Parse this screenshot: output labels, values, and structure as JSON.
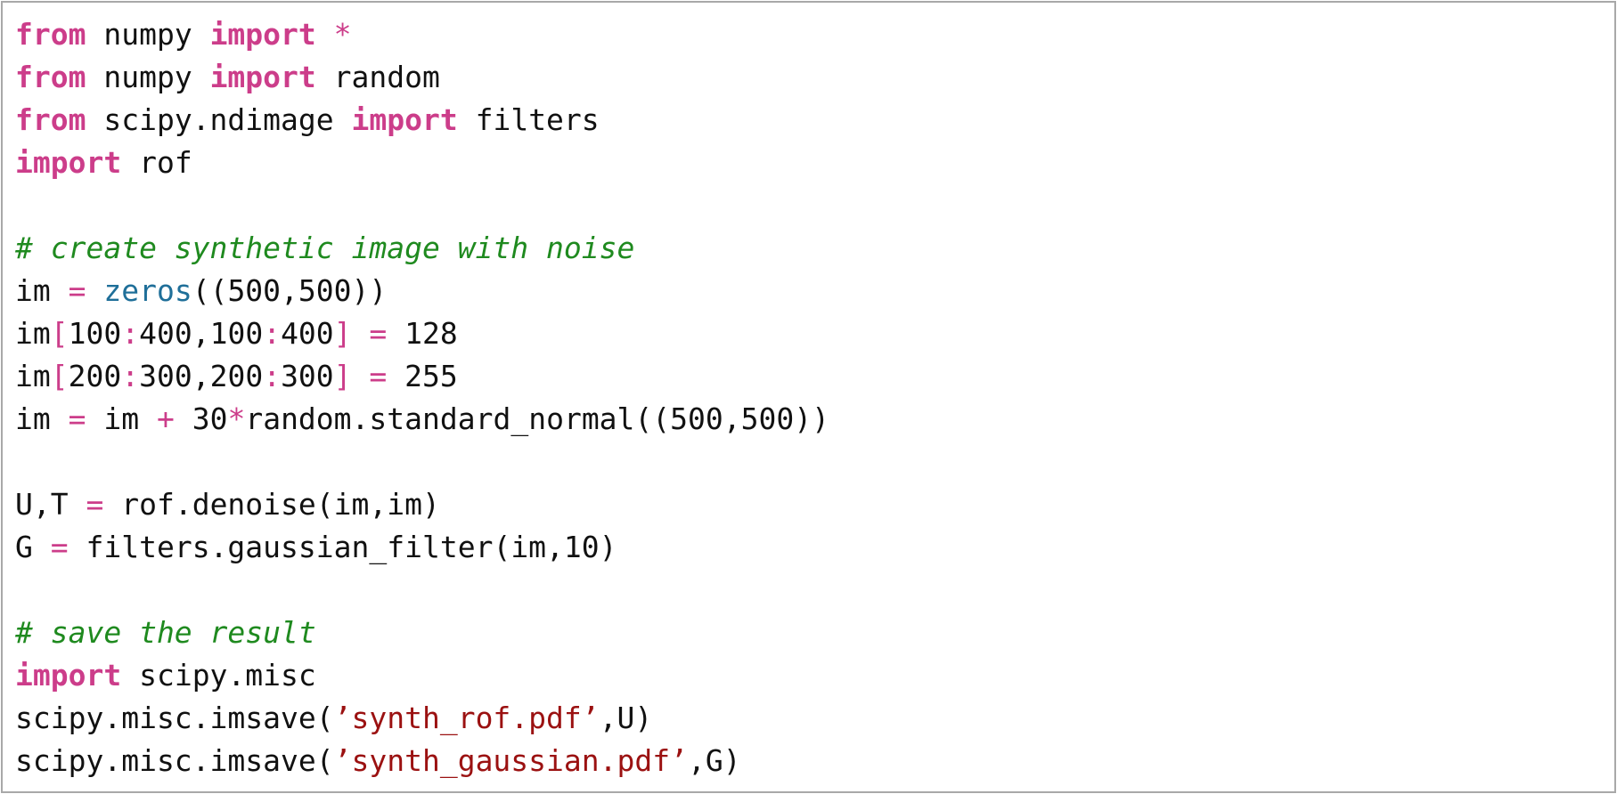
{
  "editor": {
    "lines": [
      [
        {
          "t": "kw",
          "v": "from"
        },
        {
          "t": "tx",
          "v": " numpy "
        },
        {
          "t": "kw",
          "v": "import"
        },
        {
          "t": "tx",
          "v": " "
        },
        {
          "t": "op",
          "v": "*"
        }
      ],
      [
        {
          "t": "kw",
          "v": "from"
        },
        {
          "t": "tx",
          "v": " numpy "
        },
        {
          "t": "kw",
          "v": "import"
        },
        {
          "t": "tx",
          "v": " random"
        }
      ],
      [
        {
          "t": "kw",
          "v": "from"
        },
        {
          "t": "tx",
          "v": " scipy.ndimage "
        },
        {
          "t": "kw",
          "v": "import"
        },
        {
          "t": "tx",
          "v": " filters"
        }
      ],
      [
        {
          "t": "kw",
          "v": "import"
        },
        {
          "t": "tx",
          "v": " rof"
        }
      ],
      [],
      [
        {
          "t": "cm",
          "v": "# create synthetic image with noise"
        }
      ],
      [
        {
          "t": "tx",
          "v": "im "
        },
        {
          "t": "op",
          "v": "="
        },
        {
          "t": "tx",
          "v": " "
        },
        {
          "t": "fn",
          "v": "zeros"
        },
        {
          "t": "tx",
          "v": "((500,500))"
        }
      ],
      [
        {
          "t": "tx",
          "v": "im"
        },
        {
          "t": "op",
          "v": "["
        },
        {
          "t": "tx",
          "v": "100"
        },
        {
          "t": "op",
          "v": ":"
        },
        {
          "t": "tx",
          "v": "400,100"
        },
        {
          "t": "op",
          "v": ":"
        },
        {
          "t": "tx",
          "v": "400"
        },
        {
          "t": "op",
          "v": "]"
        },
        {
          "t": "tx",
          "v": " "
        },
        {
          "t": "op",
          "v": "="
        },
        {
          "t": "tx",
          "v": " 128"
        }
      ],
      [
        {
          "t": "tx",
          "v": "im"
        },
        {
          "t": "op",
          "v": "["
        },
        {
          "t": "tx",
          "v": "200"
        },
        {
          "t": "op",
          "v": ":"
        },
        {
          "t": "tx",
          "v": "300,200"
        },
        {
          "t": "op",
          "v": ":"
        },
        {
          "t": "tx",
          "v": "300"
        },
        {
          "t": "op",
          "v": "]"
        },
        {
          "t": "tx",
          "v": " "
        },
        {
          "t": "op",
          "v": "="
        },
        {
          "t": "tx",
          "v": " 255"
        }
      ],
      [
        {
          "t": "tx",
          "v": "im "
        },
        {
          "t": "op",
          "v": "="
        },
        {
          "t": "tx",
          "v": " im "
        },
        {
          "t": "op",
          "v": "+"
        },
        {
          "t": "tx",
          "v": " 30"
        },
        {
          "t": "op",
          "v": "*"
        },
        {
          "t": "tx",
          "v": "random.standard_normal((500,500))"
        }
      ],
      [],
      [
        {
          "t": "tx",
          "v": "U,T "
        },
        {
          "t": "op",
          "v": "="
        },
        {
          "t": "tx",
          "v": " rof.denoise(im,im)"
        }
      ],
      [
        {
          "t": "tx",
          "v": "G "
        },
        {
          "t": "op",
          "v": "="
        },
        {
          "t": "tx",
          "v": " filters.gaussian_filter(im,10)"
        }
      ],
      [],
      [
        {
          "t": "cm",
          "v": "# save the result"
        }
      ],
      [
        {
          "t": "kw",
          "v": "import"
        },
        {
          "t": "tx",
          "v": " scipy.misc"
        }
      ],
      [
        {
          "t": "tx",
          "v": "scipy.misc.imsave("
        },
        {
          "t": "st",
          "v": "’synth_rof.pdf’"
        },
        {
          "t": "tx",
          "v": ",U)"
        }
      ],
      [
        {
          "t": "tx",
          "v": "scipy.misc.imsave("
        },
        {
          "t": "st",
          "v": "’synth_gaussian.pdf’"
        },
        {
          "t": "tx",
          "v": ",G)"
        }
      ]
    ]
  },
  "colors": {
    "keyword": "#cc3d8a",
    "operator": "#cc3d8a",
    "comment": "#1f8a1f",
    "builtin_function": "#1f6f99",
    "string": "#9b1111",
    "text": "#111111",
    "border": "#a8a8a8",
    "background": "#ffffff"
  }
}
